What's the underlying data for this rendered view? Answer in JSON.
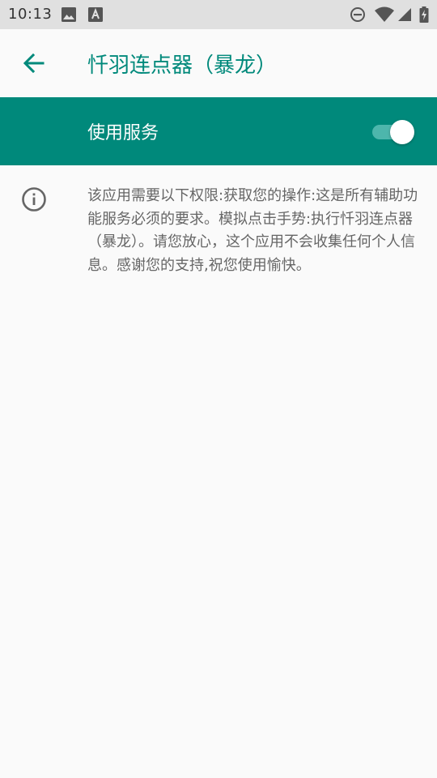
{
  "status_bar": {
    "time": "10:13",
    "left_icons": [
      "image-icon",
      "font-a-icon"
    ],
    "right_icons": [
      "do-not-disturb-icon",
      "wifi-icon",
      "signal-icon",
      "battery-charging-icon"
    ]
  },
  "app_bar": {
    "title": "忏羽连点器（暴龙）",
    "back_icon": "arrow-back-icon"
  },
  "service_switch": {
    "label": "使用服务",
    "enabled": true
  },
  "info": {
    "icon": "info-icon",
    "text": "该应用需要以下权限:获取您的操作:这是所有辅助功能服务必须的要求。模拟点击手势:执行忏羽连点器（暴龙）。请您放心，这个应用不会收集任何个人信息。感谢您的支持,祝您使用愉快。"
  },
  "colors": {
    "accent": "#00897b",
    "track_on": "#4db6ac",
    "status_bar_bg": "#e0e0e0",
    "background": "#fafafa",
    "secondary_text": "#666666"
  }
}
